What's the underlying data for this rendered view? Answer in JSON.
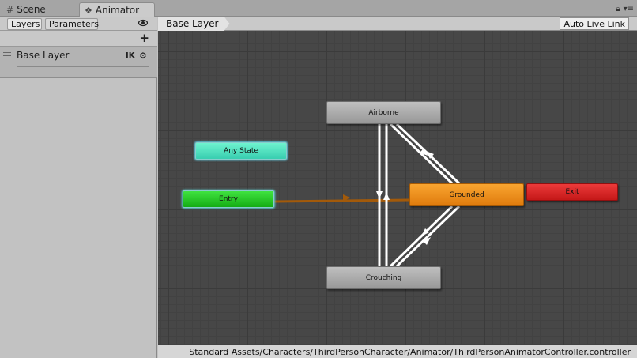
{
  "window_tabs": [
    {
      "label": "Scene",
      "icon": "grid-icon"
    },
    {
      "label": "Animator",
      "icon": "animator-icon"
    }
  ],
  "panel_tabs": {
    "layers": "Layers",
    "parameters": "Parameters"
  },
  "layer": {
    "name": "Base Layer",
    "ik_label": "IK",
    "icon": "gear-icon"
  },
  "breadcrumb": "Base Layer",
  "live_link_label": "Auto Live Link",
  "states": {
    "airborne": "Airborne",
    "grounded": "Grounded",
    "crouching": "Crouching",
    "exit": "Exit",
    "entry": "Entry",
    "any_state": "Any State"
  },
  "colors": {
    "grounded": "#f08c1c",
    "exit": "#d92525",
    "entry": "#22c522",
    "any_state": "#52e0c0",
    "state": "#aaaaaa",
    "default_transition": "#a35a0a",
    "transition": "#ffffff"
  },
  "asset_path": "Standard Assets/Characters/ThirdPersonCharacter/Animator/ThirdPersonAnimatorController.controller"
}
